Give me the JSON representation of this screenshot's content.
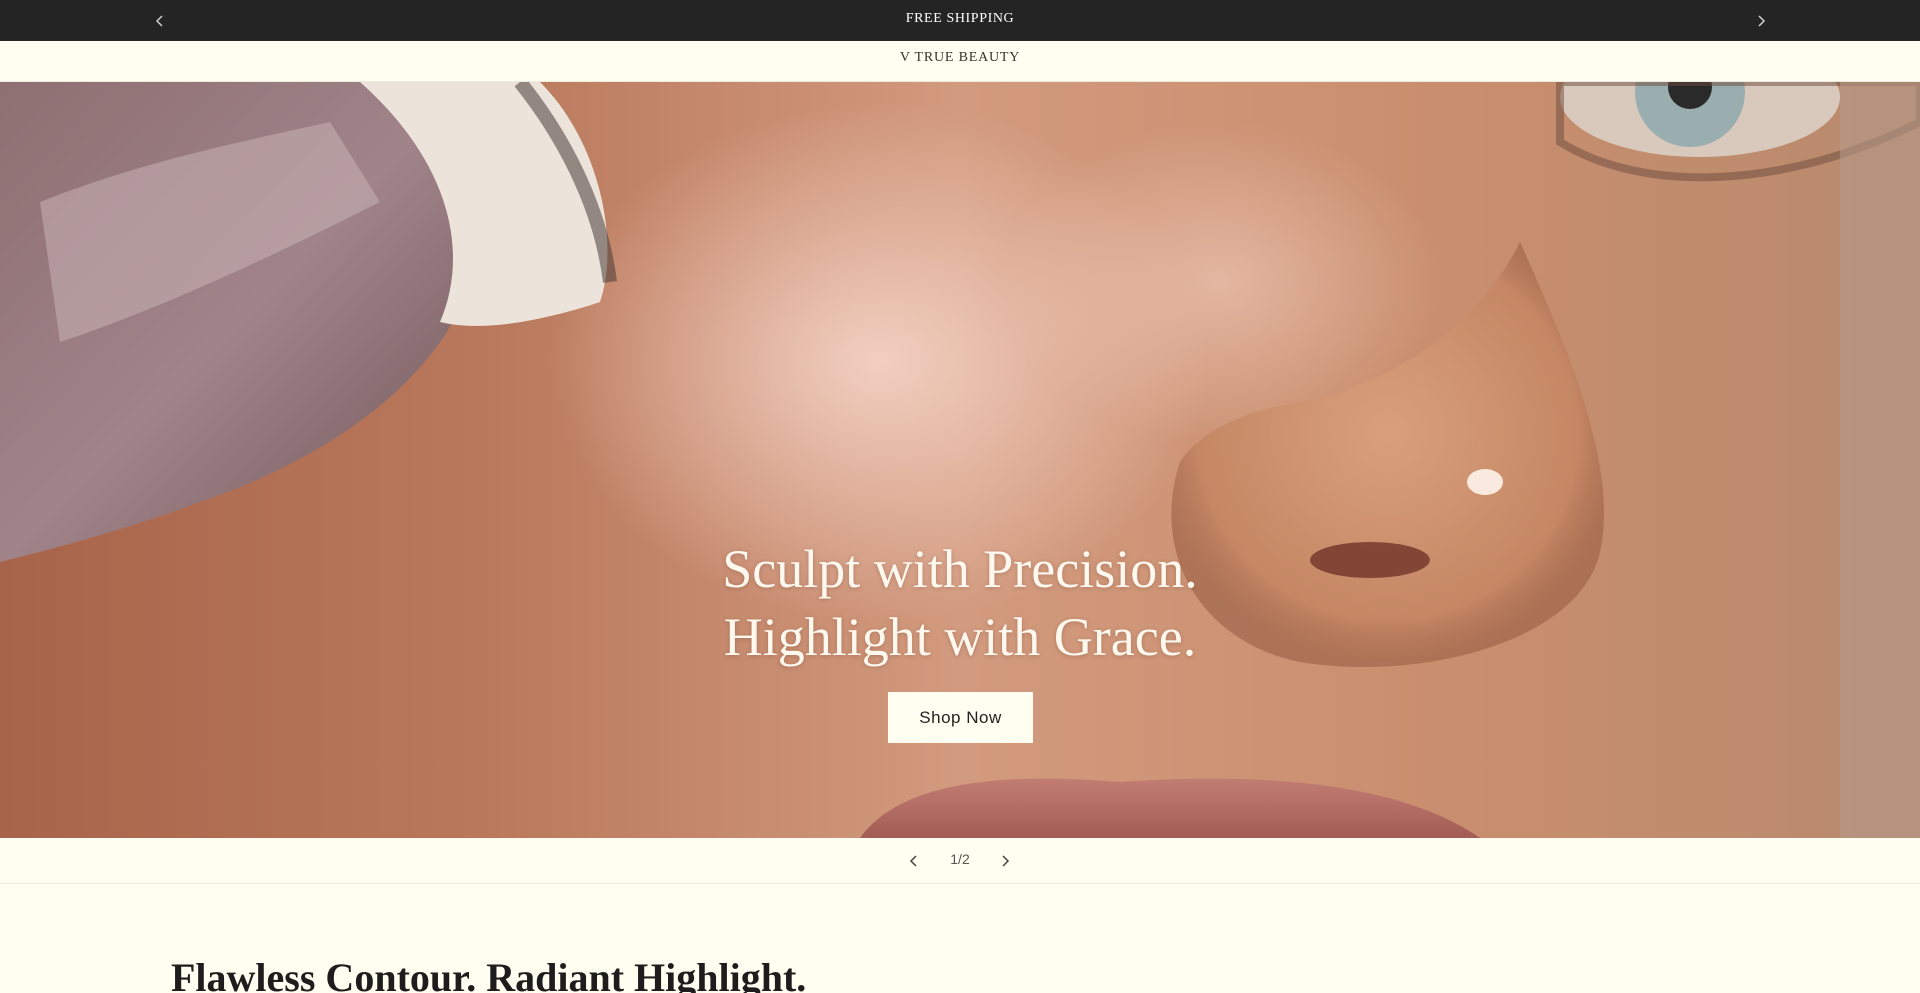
{
  "announcement": {
    "text": "FREE SHIPPING",
    "prev_icon": "chevron-left-icon",
    "next_icon": "chevron-right-icon"
  },
  "header": {
    "brand": "V TRUE BEAUTY"
  },
  "hero": {
    "headline_line1": "Sculpt with Precision.",
    "headline_line2": "Highlight with Grace.",
    "cta_label": "Shop Now"
  },
  "slider": {
    "counter": "1/2",
    "current": 1,
    "total": 2
  },
  "section": {
    "title": "Flawless Contour. Radiant Highlight."
  },
  "colors": {
    "announcement_bg": "#242424",
    "page_bg": "#fffff1",
    "hero_text": "#fff8ef"
  }
}
